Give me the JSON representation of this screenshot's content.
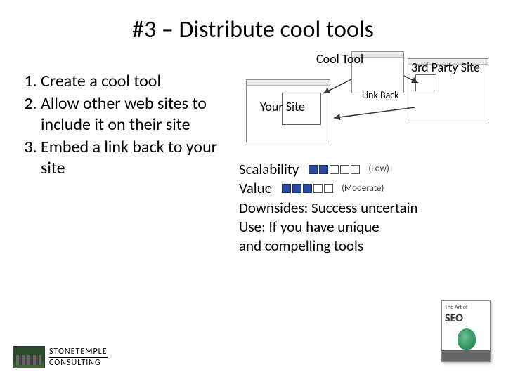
{
  "title": "#3 – Distribute cool tools",
  "list": {
    "i1": "Create a cool tool",
    "i2": "Allow other web sites to include it on their site",
    "i3": "Embed a link back to your site"
  },
  "diagram": {
    "cool_tool": "Cool Tool",
    "your_site": "Your Site",
    "third_party": "3rd Party Site",
    "link_back": "Link Back"
  },
  "metrics": {
    "scalability_label": "Scalability",
    "scalability_rating": "(Low)",
    "value_label": "Value",
    "value_rating": "(Moderate)",
    "downsides": "Downsides: Success uncertain",
    "use": "Use: If you have unique and compelling tools"
  },
  "logo": {
    "l1": "STONETEMPLE",
    "l2": "CONSULTING"
  },
  "book": {
    "small": "The Art of",
    "big": "SEO"
  }
}
